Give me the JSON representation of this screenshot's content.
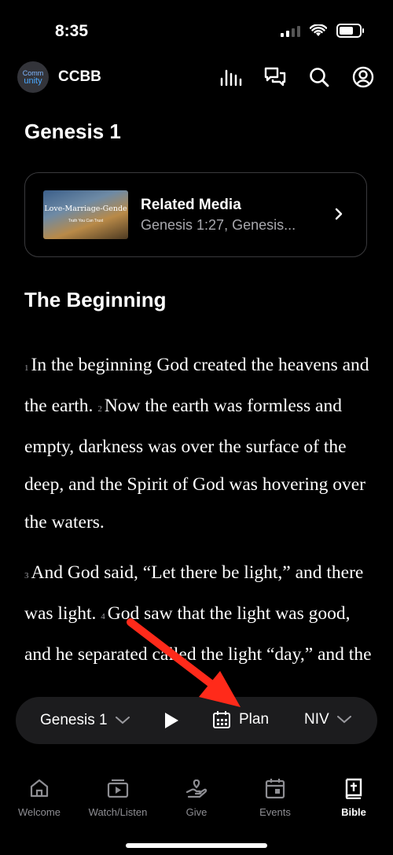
{
  "status": {
    "time": "8:35"
  },
  "header": {
    "logo_line1": "Comm",
    "logo_line2": "unity",
    "app_name": "CCBB",
    "icons": [
      "chart-bars-icon",
      "chat-icon",
      "search-icon",
      "account-icon"
    ]
  },
  "chapter_title": "Genesis 1",
  "related_media": {
    "thumbnail_title": "Love-Marriage-Gende",
    "thumbnail_subtitle": "Truth You Can Trust",
    "title": "Related Media",
    "subtitle": "Genesis 1:27, Genesis..."
  },
  "section_heading": "The Beginning",
  "verses": [
    {
      "number": "1",
      "text": "In the beginning God created the heavens and the earth."
    },
    {
      "number": "2",
      "text": "Now the earth was formless and empty, darkness was over the surface of the deep, and the Spirit of God was hovering over the waters."
    },
    {
      "number": "3",
      "text": "And God said, “Let there be light,” and there was light."
    },
    {
      "number": "4",
      "text": "God saw that the light was good, and he separated"
    },
    {
      "number": "",
      "text": "called the light “day,” and the"
    }
  ],
  "toolbar": {
    "book": "Genesis 1",
    "plan_label": "Plan",
    "version": "NIV"
  },
  "tabs": [
    {
      "label": "Welcome",
      "icon": "home-icon"
    },
    {
      "label": "Watch/Listen",
      "icon": "video-icon"
    },
    {
      "label": "Give",
      "icon": "give-icon"
    },
    {
      "label": "Events",
      "icon": "calendar-icon"
    },
    {
      "label": "Bible",
      "icon": "bible-icon",
      "active": true
    }
  ],
  "colors": {
    "background": "#000000",
    "toolbar": "#1c1c1e",
    "inactive_tab": "#8e8e93",
    "annotation_arrow": "#ff2a1a"
  }
}
